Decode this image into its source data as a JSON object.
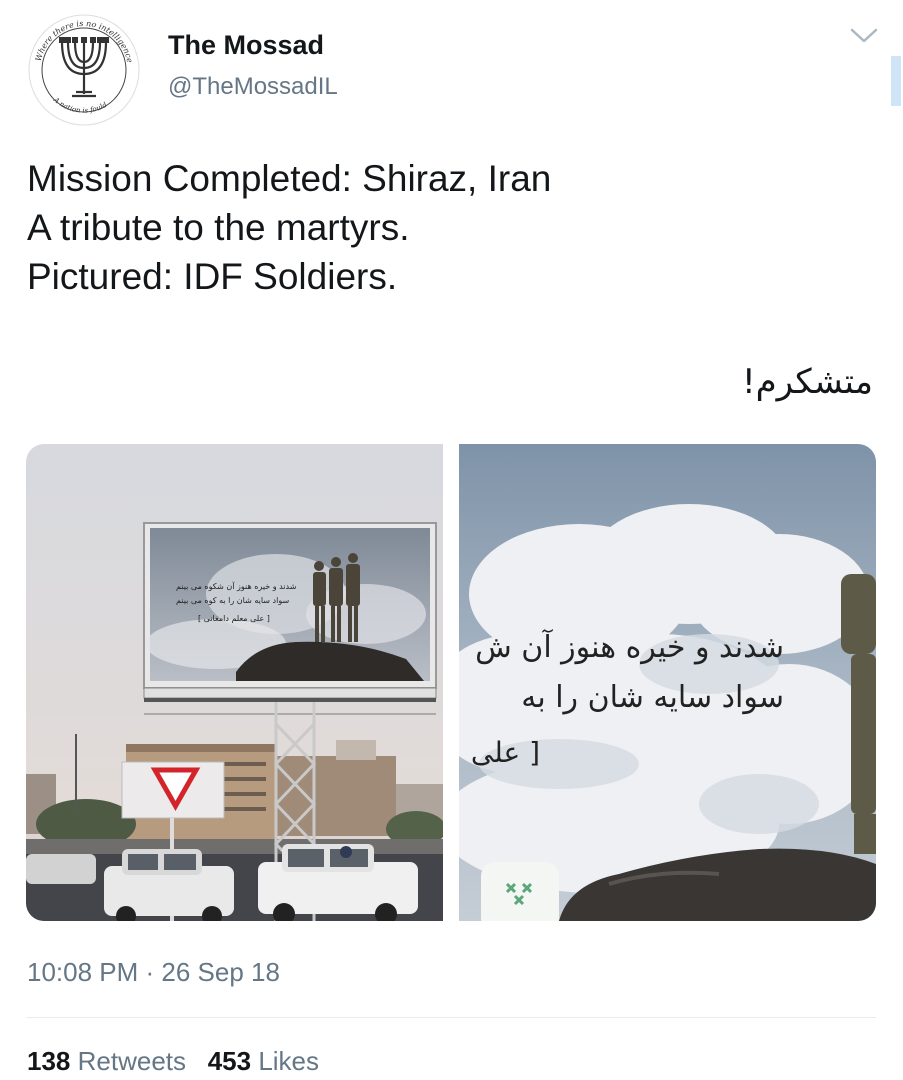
{
  "account": {
    "name": "The Mossad",
    "handle": "@TheMossadIL",
    "avatar_seal_text_top": "Where there is no intelligence",
    "avatar_seal_text_bottom": "A nation is fould"
  },
  "tweet": {
    "lines": [
      "Mission Completed: Shiraz, Iran",
      "A tribute to the martyrs.",
      "Pictured: IDF Soldiers."
    ],
    "arabic_text": "متشکرم!",
    "timestamp": "10:08 PM · 26 Sep 18"
  },
  "images": {
    "billboard_small_lines": [
      "شدند و خیره هنوز آن شکوه می بینم",
      "سواد سایه شان را به کوه می بینم",
      "[ علی معلم دامغانی ]"
    ],
    "closeup_lines": [
      "شدند و خیره هنوز آن ش",
      "سواد سایه شان را به",
      "[ علی"
    ]
  },
  "stats": {
    "retweets_count": "138",
    "retweets_label": "Retweets",
    "likes_count": "453",
    "likes_label": "Likes"
  },
  "icons": {
    "menu": "chevron-down-icon",
    "avatar": "menorah-seal-icon"
  },
  "colors": {
    "text": "#14171a",
    "secondary": "#657786",
    "divider": "#e6ecf0"
  }
}
